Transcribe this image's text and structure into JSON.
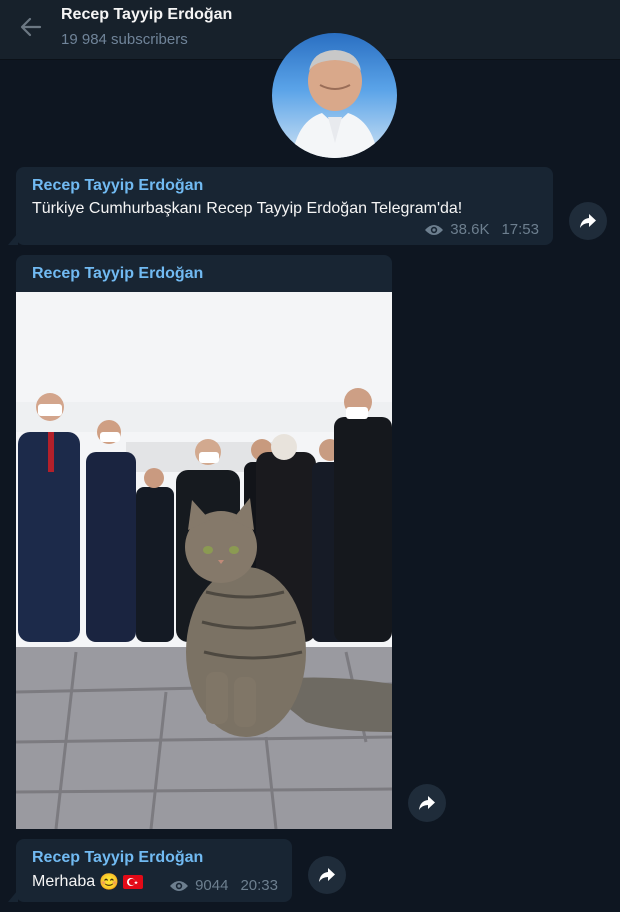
{
  "header": {
    "title": "Recep Tayyip Erdoğan",
    "subscribers": "19 984 subscribers"
  },
  "messages": [
    {
      "author": "Recep Tayyip Erdoğan",
      "text": "Türkiye Cumhurbaşkanı Recep Tayyip Erdoğan Telegram'da!",
      "views": "38.6K",
      "time": "17:53"
    },
    {
      "author": "Recep Tayyip Erdoğan"
    },
    {
      "author": "Recep Tayyip Erdoğan",
      "text": "Merhaba",
      "emoji": "😊",
      "flag": "🇹🇷",
      "views": "9044",
      "time": "20:33"
    }
  ],
  "icons": {
    "back": "arrow-left-icon",
    "views": "eye-icon",
    "forward": "share-arrow-icon"
  },
  "colors": {
    "background": "#0e1621",
    "header": "#17212b",
    "bubble": "#182533",
    "author": "#71baf2",
    "meta": "#6d7f8f"
  }
}
